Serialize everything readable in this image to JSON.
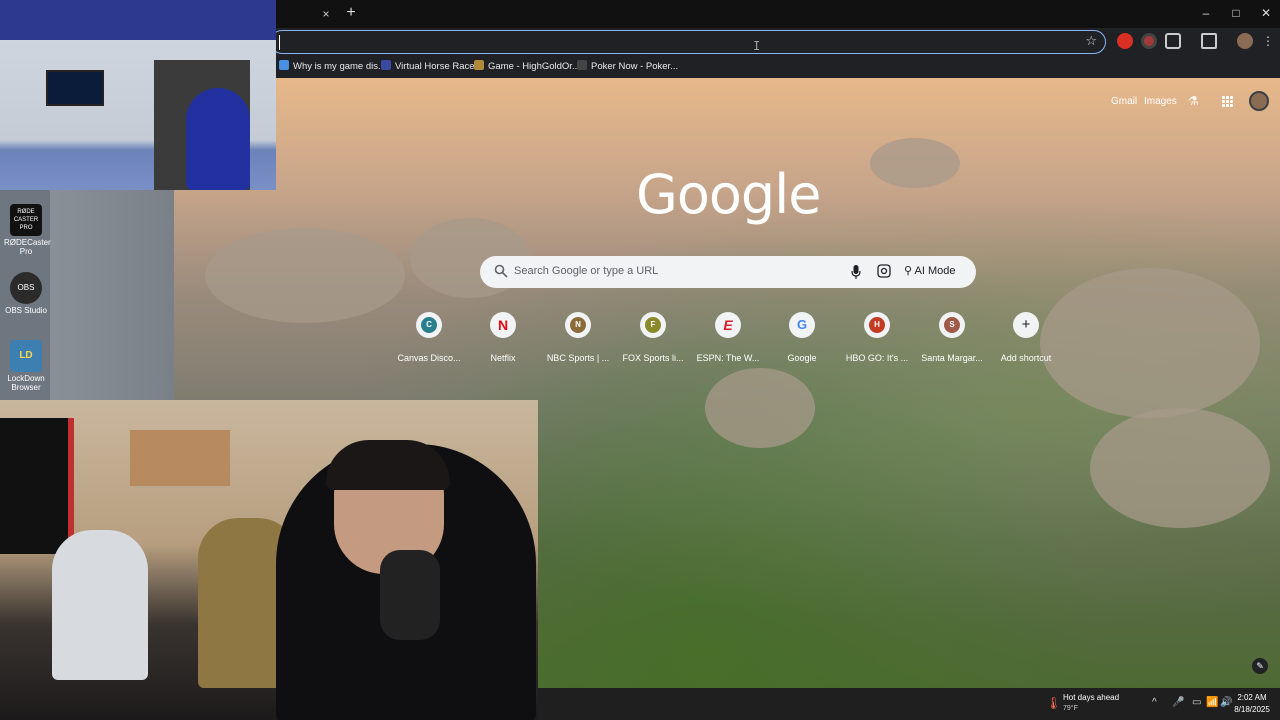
{
  "browser": {
    "tab_close": "×",
    "new_tab": "+",
    "window": {
      "minimize": "–",
      "maximize": "□",
      "close": "✕"
    },
    "omnibox": {
      "value": "",
      "ibeam": "I",
      "star": "☆"
    },
    "bookmarks": [
      {
        "label": "Why is my game dis...",
        "color": "#4a90e2"
      },
      {
        "label": "Virtual Horse Races",
        "color": "#3a4aa0"
      },
      {
        "label": "Game - HighGoldOr...",
        "color": "#b08a3a"
      },
      {
        "label": "Poker Now - Poker...",
        "color": "#444444"
      }
    ]
  },
  "ntp": {
    "gmail": "Gmail",
    "images": "Images",
    "logo": "Google",
    "search": {
      "placeholder": "Search Google or type a URL",
      "ai_mode": "AI Mode"
    },
    "shortcuts": [
      {
        "label": "Canvas Disco...",
        "letter": "C",
        "color": "#2a7f8f"
      },
      {
        "label": "Netflix",
        "letter": "N",
        "color": "#e50914"
      },
      {
        "label": "NBC Sports | ...",
        "letter": "N",
        "color": "#8b6b3a"
      },
      {
        "label": "FOX Sports li...",
        "letter": "F",
        "color": "#8a8a2a"
      },
      {
        "label": "ESPN: The W...",
        "letter": "E",
        "color": "#d61f26"
      },
      {
        "label": "Google",
        "letter": "G",
        "color": "#4285f4"
      },
      {
        "label": "HBO GO: It's ...",
        "letter": "H",
        "color": "#c23b22"
      },
      {
        "label": "Santa Margar...",
        "letter": "S",
        "color": "#a05a4a"
      },
      {
        "label": "Add shortcut",
        "letter": "+",
        "color": "#202124"
      }
    ],
    "edit": "✎"
  },
  "desktop": {
    "icons": [
      {
        "label": "RØDECaster Pro",
        "color": "#111111",
        "mark": "RØDE CASTER PRO"
      },
      {
        "label": "OBS Studio",
        "color": "#2b2b2b",
        "mark": "OBS"
      },
      {
        "label": "LockDown Browser",
        "color": "#3c7fb0",
        "mark": "LD"
      }
    ]
  },
  "taskbar": {
    "weather_title": "Hot days ahead",
    "weather_temp": "79°F",
    "tray": [
      "^",
      "🎤",
      "▭",
      "📶",
      "🔊"
    ],
    "time": "2:02 AM",
    "date": "8/18/2025"
  }
}
